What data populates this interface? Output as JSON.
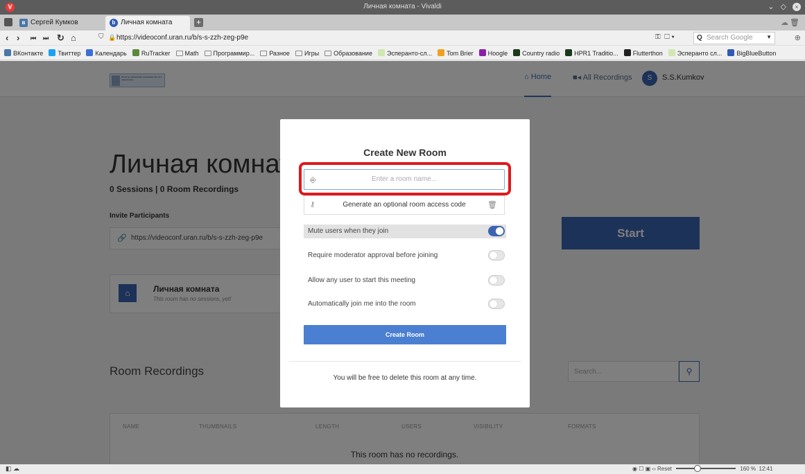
{
  "window": {
    "title": "Личная комната - Vivaldi",
    "controls": "⌄ ◇",
    "close": "×"
  },
  "tabs": [
    {
      "icon": "vk-icon",
      "label": "Сергей Кумков"
    },
    {
      "icon": "bigbluebutton-icon",
      "label": "Личная комната"
    }
  ],
  "address": {
    "url": "https://videoconf.uran.ru/b/s-s-zzh-zeg-p9e",
    "search_placeholder": "Search Google"
  },
  "bookmarks": [
    {
      "label": "ВКонтакте",
      "icon": "vk-icon",
      "color": "#4a76a8"
    },
    {
      "label": "Твиттер",
      "icon": "twitter-icon",
      "color": "#1da1f2"
    },
    {
      "label": "Календарь",
      "icon": "calendar-icon",
      "color": "#3b6ed8"
    },
    {
      "label": "RuTracker",
      "icon": "rutracker-icon",
      "color": "#5a8a3a"
    },
    {
      "label": "Math",
      "icon": "folder-icon"
    },
    {
      "label": "Программир...",
      "icon": "folder-icon"
    },
    {
      "label": "Разное",
      "icon": "folder-icon"
    },
    {
      "label": "Игры",
      "icon": "folder-icon"
    },
    {
      "label": "Образование",
      "icon": "folder-icon"
    },
    {
      "label": "Эсперанто-сл...",
      "icon": "esperanto-icon",
      "color": "#cfe8b0"
    },
    {
      "label": "Tom Brier",
      "icon": "tombrier-icon",
      "color": "#f0a020"
    },
    {
      "label": "Hoogle",
      "icon": "hoogle-icon",
      "color": "#8b1fa9"
    },
    {
      "label": "Country radio",
      "icon": "countryradio-icon",
      "color": "#1a3a1a"
    },
    {
      "label": "HPR1 Traditio...",
      "icon": "hpr1-icon",
      "color": "#1a3a1a"
    },
    {
      "label": "Flutterthon",
      "icon": "github-icon",
      "color": "#222222"
    },
    {
      "label": "Эсперанто сл...",
      "icon": "esperanto-icon",
      "color": "#cfe8b0"
    },
    {
      "label": "BigBlueButton",
      "icon": "bigbluebutton-icon",
      "color": "#2f5bb7"
    }
  ],
  "site": {
    "logo_text": "Институт математики и механики им. Н.Н. Красовского",
    "nav_home": "Home",
    "nav_recordings": "All Recordings",
    "avatar_initial": "S",
    "user_name": "S.S.Kumkov"
  },
  "room": {
    "title": "Личная комната",
    "stats": "0 Sessions | 0 Room Recordings",
    "invite_label": "Invite Participants",
    "invite_url": "https://videoconf.uran.ru/b/s-s-zzh-zeg-p9e",
    "start_label": "Start",
    "card_name": "Личная комната",
    "card_sub": "This room has no sessions, yet!"
  },
  "recordings": {
    "title": "Room Recordings",
    "search_placeholder": "Search...",
    "columns": [
      "NAME",
      "THUMBNAILS",
      "LENGTH",
      "USERS",
      "VISIBILITY",
      "FORMATS"
    ],
    "empty": "This room has no recordings."
  },
  "modal": {
    "title": "Create New Room",
    "name_placeholder": "Enter a room name...",
    "access_code_label": "Generate an optional room access code",
    "options": [
      {
        "label": "Mute users when they join",
        "on": true
      },
      {
        "label": "Require moderator approval before joining",
        "on": false
      },
      {
        "label": "Allow any user to start this meeting",
        "on": false
      },
      {
        "label": "Automatically join me into the room",
        "on": false
      }
    ],
    "create_label": "Create Room",
    "footer": "You will be free to delete this room at any time."
  },
  "statusbar": {
    "reset": "Reset",
    "zoom": "160 %",
    "time": "12:41"
  }
}
